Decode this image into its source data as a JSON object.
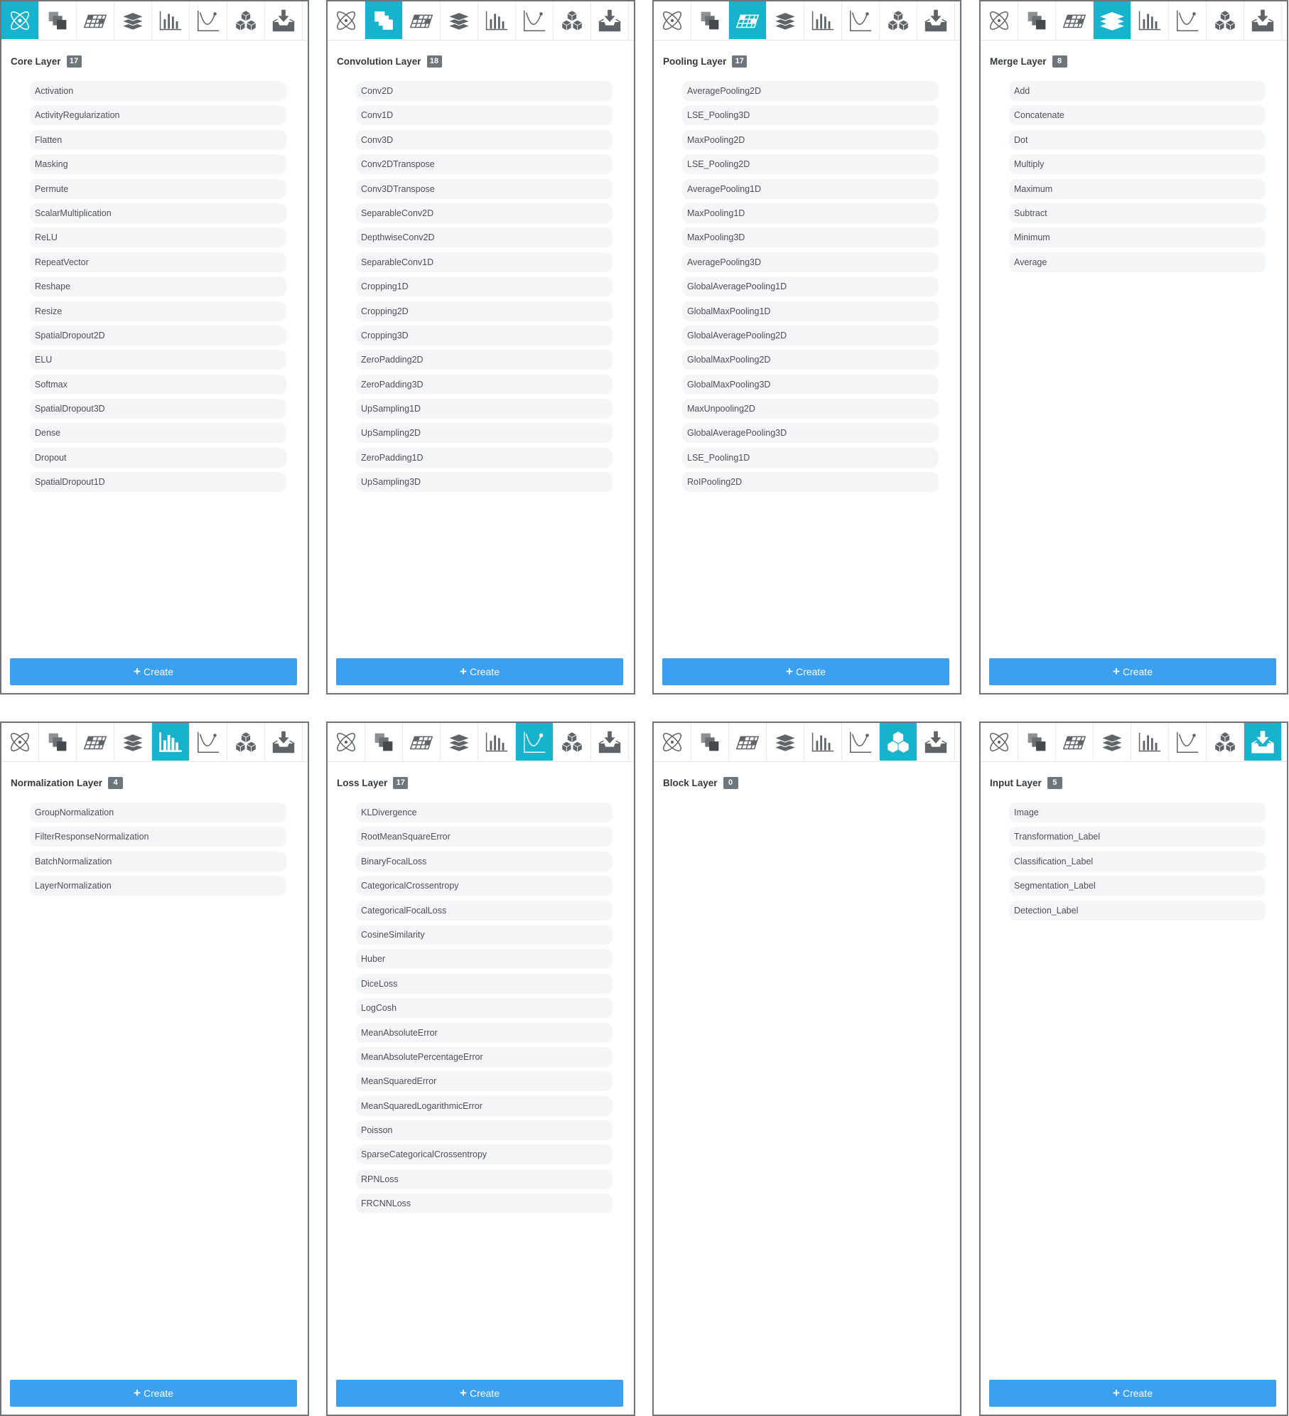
{
  "toolbar_icons": [
    "atom-icon",
    "conv-squares-icon",
    "pooling-grid-icon",
    "layers-stack-icon",
    "bar-chart-icon",
    "loss-curve-icon",
    "cubes-icon",
    "download-tray-icon"
  ],
  "accent_color": "#17b2cb",
  "create_label": "Create",
  "panels": [
    {
      "title": "Core Layer",
      "count": "17",
      "active": 0,
      "has_create": true,
      "items": [
        "Activation",
        "ActivityRegularization",
        "Flatten",
        "Masking",
        "Permute",
        "ScalarMultiplication",
        "ReLU",
        "RepeatVector",
        "Reshape",
        "Resize",
        "SpatialDropout2D",
        "ELU",
        "Softmax",
        "SpatialDropout3D",
        "Dense",
        "Dropout",
        "SpatialDropout1D"
      ]
    },
    {
      "title": "Convolution Layer",
      "count": "18",
      "active": 1,
      "has_create": true,
      "items": [
        "Conv2D",
        "Conv1D",
        "Conv3D",
        "Conv2DTranspose",
        "Conv3DTranspose",
        "SeparableConv2D",
        "DepthwiseConv2D",
        "SeparableConv1D",
        "Cropping1D",
        "Cropping2D",
        "Cropping3D",
        "ZeroPadding2D",
        "ZeroPadding3D",
        "UpSampling1D",
        "UpSampling2D",
        "ZeroPadding1D",
        "UpSampling3D"
      ]
    },
    {
      "title": "Pooling Layer",
      "count": "17",
      "active": 2,
      "has_create": true,
      "items": [
        "AveragePooling2D",
        "LSE_Pooling3D",
        "MaxPooling2D",
        "LSE_Pooling2D",
        "AveragePooling1D",
        "MaxPooling1D",
        "MaxPooling3D",
        "AveragePooling3D",
        "GlobalAveragePooling1D",
        "GlobalMaxPooling1D",
        "GlobalAveragePooling2D",
        "GlobalMaxPooling2D",
        "GlobalMaxPooling3D",
        "MaxUnpooling2D",
        "GlobalAveragePooling3D",
        "LSE_Pooling1D",
        "RoIPooling2D"
      ]
    },
    {
      "title": "Merge Layer",
      "count": "8",
      "active": 3,
      "has_create": true,
      "items": [
        "Add",
        "Concatenate",
        "Dot",
        "Multiply",
        "Maximum",
        "Subtract",
        "Minimum",
        "Average"
      ]
    },
    {
      "title": "Normalization Layer",
      "count": "4",
      "active": 4,
      "has_create": true,
      "items": [
        "GroupNormalization",
        "FilterResponseNormalization",
        "BatchNormalization",
        "LayerNormalization"
      ]
    },
    {
      "title": "Loss Layer",
      "count": "17",
      "active": 5,
      "has_create": true,
      "items": [
        "KLDivergence",
        "RootMeanSquareError",
        "BinaryFocalLoss",
        "CategoricalCrossentropy",
        "CategoricalFocalLoss",
        "CosineSimilarity",
        "Huber",
        "DiceLoss",
        "LogCosh",
        "MeanAbsoluteError",
        "MeanAbsolutePercentageError",
        "MeanSquaredError",
        "MeanSquaredLogarithmicError",
        "Poisson",
        "SparseCategoricalCrossentropy",
        "RPNLoss",
        "FRCNNLoss"
      ]
    },
    {
      "title": "Block Layer",
      "count": "0",
      "active": 6,
      "has_create": false,
      "items": []
    },
    {
      "title": "Input Layer",
      "count": "5",
      "active": 7,
      "has_create": true,
      "items": [
        "Image",
        "Transformation_Label",
        "Classification_Label",
        "Segmentation_Label",
        "Detection_Label"
      ]
    }
  ]
}
